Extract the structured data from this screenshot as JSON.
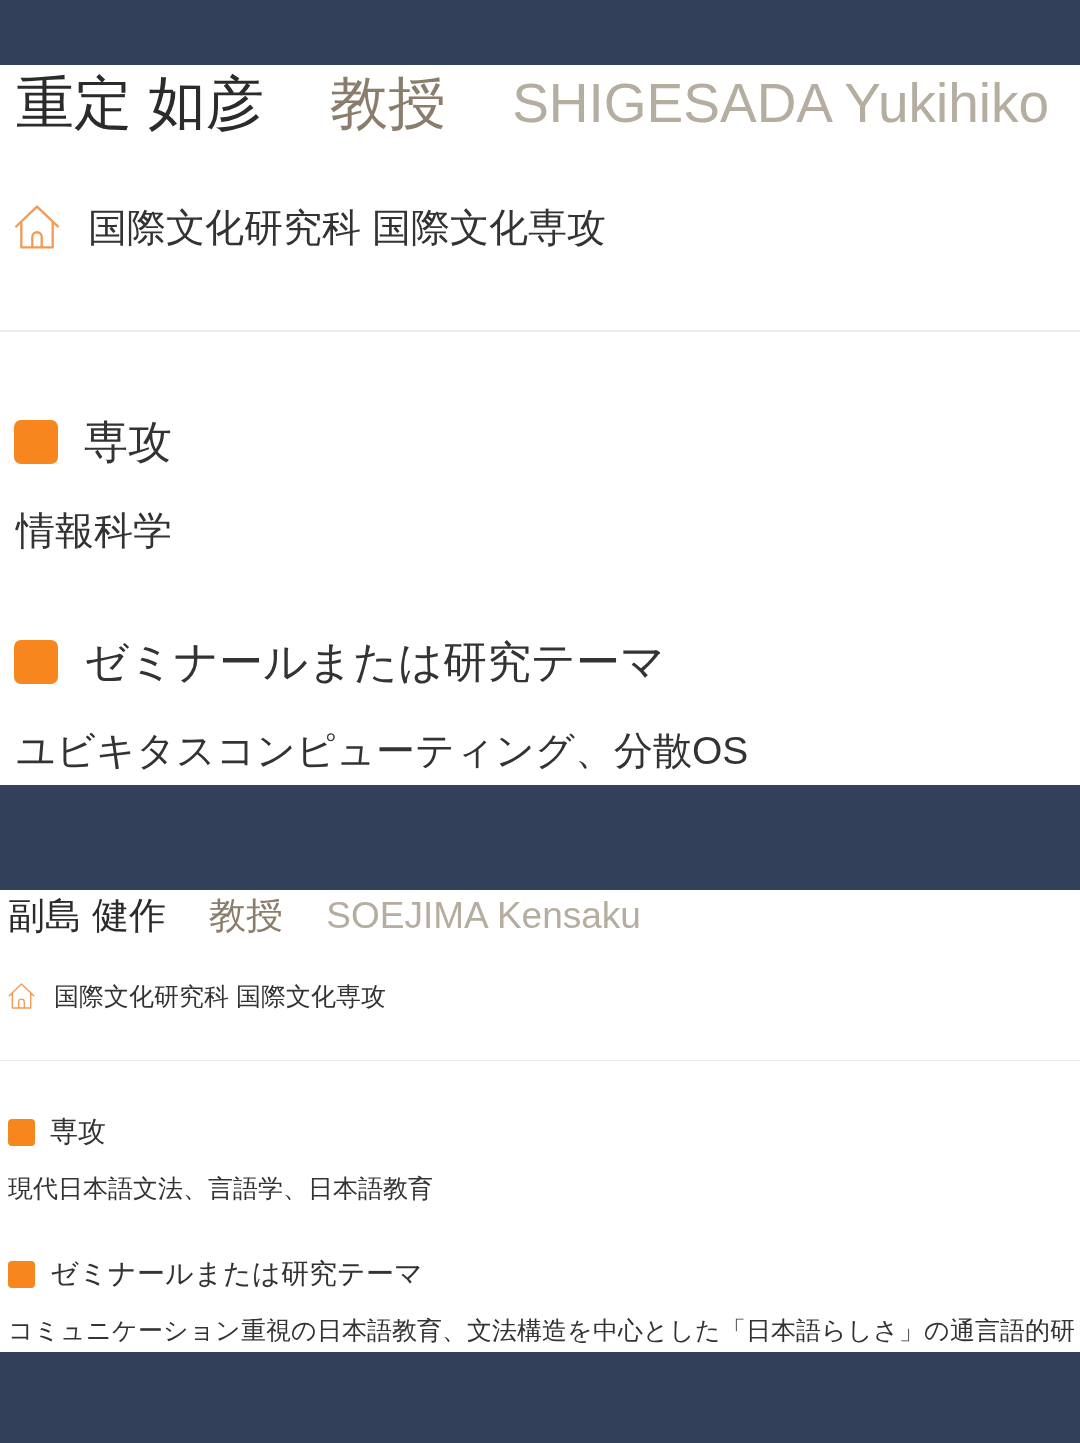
{
  "profiles": [
    {
      "name": "重定 如彦",
      "title": "教授",
      "name_romaji": "SHIGESADA Yukihiko",
      "affiliation": "国際文化研究科 国際文化専攻",
      "sections": [
        {
          "heading": "専攻",
          "body": "情報科学"
        },
        {
          "heading": "ゼミナールまたは研究テーマ",
          "body": "ユビキタスコンピューティング、分散OS"
        }
      ]
    },
    {
      "name": "副島 健作",
      "title": "教授",
      "name_romaji": "SOEJIMA Kensaku",
      "affiliation": "国際文化研究科 国際文化専攻",
      "sections": [
        {
          "heading": "専攻",
          "body": "現代日本語文法、言語学、日本語教育"
        },
        {
          "heading": "ゼミナールまたは研究テーマ",
          "body": "コミュニケーション重視の日本語教育、文法構造を中心とした「日本語らしさ」の通言語的研"
        }
      ]
    }
  ]
}
